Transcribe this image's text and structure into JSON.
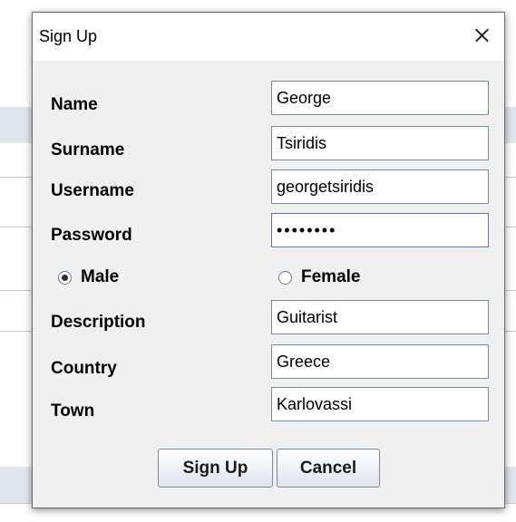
{
  "dialog": {
    "title": "Sign Up",
    "close_label": "×"
  },
  "form": {
    "name_label": "Name",
    "name_value": "George",
    "surname_label": "Surname",
    "surname_value": "Tsiridis",
    "username_label": "Username",
    "username_value": "georgetsiridis",
    "password_label": "Password",
    "password_masked": "••••••••",
    "gender": {
      "male_label": "Male",
      "female_label": "Female",
      "selected": "Male"
    },
    "description_label": "Description",
    "description_value": "Guitarist",
    "country_label": "Country",
    "country_value": "Greece",
    "town_label": "Town",
    "town_value": "Karlovassi"
  },
  "buttons": {
    "signup_label": "Sign Up",
    "cancel_label": "Cancel"
  },
  "colors": {
    "dialog_bg": "#f0f0f0",
    "titlebar_bg": "#ffffff",
    "field_border": "#7a8a9a",
    "focus_border": "#5a7aa6"
  }
}
